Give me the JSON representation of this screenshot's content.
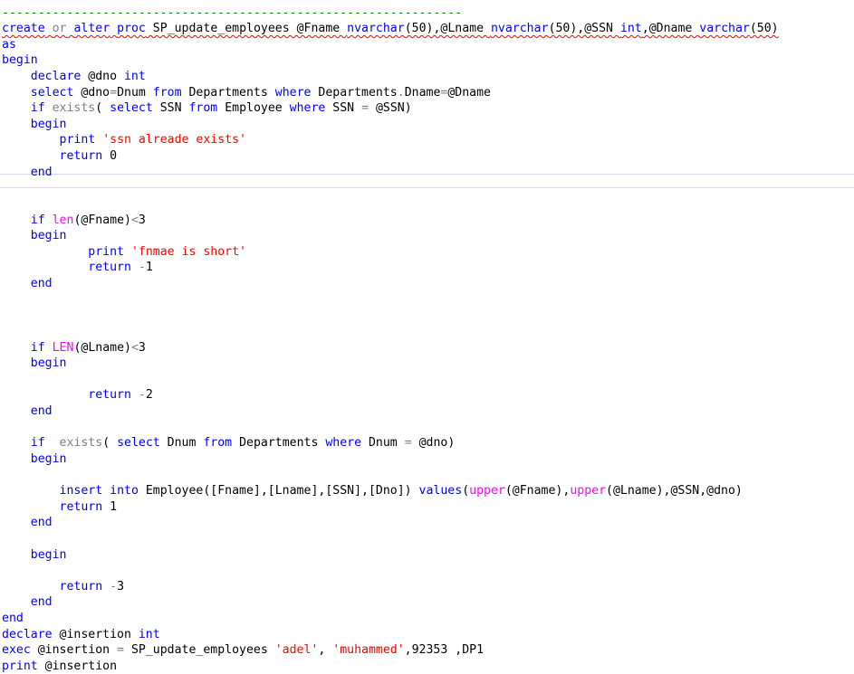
{
  "editor": {
    "lines": [
      {
        "tokens": [
          {
            "t": "----------------------------------------------------------------",
            "c": "cmt"
          }
        ]
      },
      {
        "tokens": [
          {
            "t": "create",
            "c": "kw",
            "err": true
          },
          {
            "t": " ",
            "c": "txt",
            "err": true
          },
          {
            "t": "or",
            "c": "op",
            "err": true
          },
          {
            "t": " ",
            "c": "txt",
            "err": true
          },
          {
            "t": "alter",
            "c": "kw",
            "err": true
          },
          {
            "t": " ",
            "c": "txt",
            "err": true
          },
          {
            "t": "proc",
            "c": "kw",
            "err": true
          },
          {
            "t": " SP_update_employees @Fname ",
            "c": "txt",
            "err": true
          },
          {
            "t": "nvarchar",
            "c": "kw",
            "err": true
          },
          {
            "t": "(50),@Lname ",
            "c": "txt",
            "err": true
          },
          {
            "t": "nvarchar",
            "c": "kw",
            "err": true
          },
          {
            "t": "(50),@SSN ",
            "c": "txt",
            "err": true
          },
          {
            "t": "int",
            "c": "kw",
            "err": true
          },
          {
            "t": ",@Dname ",
            "c": "txt",
            "err": true
          },
          {
            "t": "varchar",
            "c": "kw",
            "err": true
          },
          {
            "t": "(50)",
            "c": "txt",
            "err": true
          }
        ]
      },
      {
        "tokens": [
          {
            "t": "as",
            "c": "kw"
          }
        ]
      },
      {
        "tokens": [
          {
            "t": "begin",
            "c": "kw"
          }
        ]
      },
      {
        "tokens": [
          {
            "t": "    ",
            "c": "txt"
          },
          {
            "t": "declare",
            "c": "kw"
          },
          {
            "t": " @dno ",
            "c": "txt"
          },
          {
            "t": "int",
            "c": "kw"
          }
        ]
      },
      {
        "tokens": [
          {
            "t": "    ",
            "c": "txt"
          },
          {
            "t": "select",
            "c": "kw"
          },
          {
            "t": " @dno",
            "c": "txt"
          },
          {
            "t": "=",
            "c": "op"
          },
          {
            "t": "Dnum ",
            "c": "txt"
          },
          {
            "t": "from",
            "c": "kw"
          },
          {
            "t": " Departments ",
            "c": "txt"
          },
          {
            "t": "where",
            "c": "kw"
          },
          {
            "t": " Departments",
            "c": "txt"
          },
          {
            "t": ".",
            "c": "op"
          },
          {
            "t": "Dname",
            "c": "txt"
          },
          {
            "t": "=",
            "c": "op"
          },
          {
            "t": "@Dname",
            "c": "txt"
          }
        ]
      },
      {
        "tokens": [
          {
            "t": "    ",
            "c": "txt"
          },
          {
            "t": "if",
            "c": "kw"
          },
          {
            "t": " ",
            "c": "txt"
          },
          {
            "t": "exists",
            "c": "op"
          },
          {
            "t": "( ",
            "c": "txt"
          },
          {
            "t": "select",
            "c": "kw"
          },
          {
            "t": " SSN ",
            "c": "txt"
          },
          {
            "t": "from",
            "c": "kw"
          },
          {
            "t": " Employee ",
            "c": "txt"
          },
          {
            "t": "where",
            "c": "kw"
          },
          {
            "t": " SSN ",
            "c": "txt"
          },
          {
            "t": "=",
            "c": "op"
          },
          {
            "t": " @SSN)",
            "c": "txt"
          }
        ]
      },
      {
        "tokens": [
          {
            "t": "    ",
            "c": "txt"
          },
          {
            "t": "begin",
            "c": "kw"
          }
        ]
      },
      {
        "tokens": [
          {
            "t": "        ",
            "c": "txt"
          },
          {
            "t": "print",
            "c": "kw"
          },
          {
            "t": " ",
            "c": "txt"
          },
          {
            "t": "'ssn alreade exists'",
            "c": "str"
          }
        ]
      },
      {
        "tokens": [
          {
            "t": "        ",
            "c": "txt"
          },
          {
            "t": "return",
            "c": "kw"
          },
          {
            "t": " 0",
            "c": "txt"
          }
        ]
      },
      {
        "tokens": [
          {
            "t": "    ",
            "c": "txt"
          },
          {
            "t": "end",
            "c": "kw"
          }
        ]
      },
      {
        "tokens": []
      },
      {
        "tokens": []
      },
      {
        "tokens": [
          {
            "t": "    ",
            "c": "txt"
          },
          {
            "t": "if",
            "c": "kw"
          },
          {
            "t": " ",
            "c": "txt"
          },
          {
            "t": "len",
            "c": "fn"
          },
          {
            "t": "(@Fname)",
            "c": "txt"
          },
          {
            "t": "<",
            "c": "op"
          },
          {
            "t": "3",
            "c": "txt"
          }
        ]
      },
      {
        "tokens": [
          {
            "t": "    ",
            "c": "txt"
          },
          {
            "t": "begin",
            "c": "kw"
          }
        ]
      },
      {
        "tokens": [
          {
            "t": "            ",
            "c": "txt"
          },
          {
            "t": "print",
            "c": "kw"
          },
          {
            "t": " ",
            "c": "txt"
          },
          {
            "t": "'fnmae is short'",
            "c": "str"
          }
        ]
      },
      {
        "tokens": [
          {
            "t": "            ",
            "c": "txt"
          },
          {
            "t": "return",
            "c": "kw"
          },
          {
            "t": " ",
            "c": "txt"
          },
          {
            "t": "-",
            "c": "op"
          },
          {
            "t": "1",
            "c": "txt"
          }
        ]
      },
      {
        "tokens": [
          {
            "t": "    ",
            "c": "txt"
          },
          {
            "t": "end",
            "c": "kw"
          }
        ]
      },
      {
        "tokens": []
      },
      {
        "tokens": []
      },
      {
        "tokens": []
      },
      {
        "tokens": [
          {
            "t": "    ",
            "c": "txt"
          },
          {
            "t": "if",
            "c": "kw"
          },
          {
            "t": " ",
            "c": "txt"
          },
          {
            "t": "LEN",
            "c": "fn"
          },
          {
            "t": "(@Lname)",
            "c": "txt"
          },
          {
            "t": "<",
            "c": "op"
          },
          {
            "t": "3",
            "c": "txt"
          }
        ]
      },
      {
        "tokens": [
          {
            "t": "    ",
            "c": "txt"
          },
          {
            "t": "begin",
            "c": "kw"
          }
        ]
      },
      {
        "tokens": []
      },
      {
        "tokens": [
          {
            "t": "            ",
            "c": "txt"
          },
          {
            "t": "return",
            "c": "kw"
          },
          {
            "t": " ",
            "c": "txt"
          },
          {
            "t": "-",
            "c": "op"
          },
          {
            "t": "2",
            "c": "txt"
          }
        ]
      },
      {
        "tokens": [
          {
            "t": "    ",
            "c": "txt"
          },
          {
            "t": "end",
            "c": "kw"
          }
        ]
      },
      {
        "tokens": []
      },
      {
        "tokens": [
          {
            "t": "    ",
            "c": "txt"
          },
          {
            "t": "if",
            "c": "kw"
          },
          {
            "t": "  ",
            "c": "txt"
          },
          {
            "t": "exists",
            "c": "op"
          },
          {
            "t": "( ",
            "c": "txt"
          },
          {
            "t": "select",
            "c": "kw"
          },
          {
            "t": " Dnum ",
            "c": "txt"
          },
          {
            "t": "from",
            "c": "kw"
          },
          {
            "t": " Departments ",
            "c": "txt"
          },
          {
            "t": "where",
            "c": "kw"
          },
          {
            "t": " Dnum ",
            "c": "txt"
          },
          {
            "t": "=",
            "c": "op"
          },
          {
            "t": " @dno)",
            "c": "txt"
          }
        ]
      },
      {
        "tokens": [
          {
            "t": "    ",
            "c": "txt"
          },
          {
            "t": "begin",
            "c": "kw"
          }
        ]
      },
      {
        "tokens": []
      },
      {
        "tokens": [
          {
            "t": "        ",
            "c": "txt"
          },
          {
            "t": "insert",
            "c": "kw"
          },
          {
            "t": " ",
            "c": "txt"
          },
          {
            "t": "into",
            "c": "kw"
          },
          {
            "t": " Employee([Fname],[Lname],[SSN],[Dno]) ",
            "c": "txt"
          },
          {
            "t": "values",
            "c": "kw"
          },
          {
            "t": "(",
            "c": "txt"
          },
          {
            "t": "upper",
            "c": "fn"
          },
          {
            "t": "(@Fname),",
            "c": "txt"
          },
          {
            "t": "upper",
            "c": "fn"
          },
          {
            "t": "(@Lname),@SSN,@dno)",
            "c": "txt"
          }
        ]
      },
      {
        "tokens": [
          {
            "t": "        ",
            "c": "txt"
          },
          {
            "t": "return",
            "c": "kw"
          },
          {
            "t": " 1",
            "c": "txt"
          }
        ]
      },
      {
        "tokens": [
          {
            "t": "    ",
            "c": "txt"
          },
          {
            "t": "end",
            "c": "kw"
          }
        ]
      },
      {
        "tokens": []
      },
      {
        "tokens": [
          {
            "t": "    ",
            "c": "txt"
          },
          {
            "t": "begin",
            "c": "kw"
          }
        ]
      },
      {
        "tokens": []
      },
      {
        "tokens": [
          {
            "t": "        ",
            "c": "txt"
          },
          {
            "t": "return",
            "c": "kw"
          },
          {
            "t": " ",
            "c": "txt"
          },
          {
            "t": "-",
            "c": "op"
          },
          {
            "t": "3",
            "c": "txt"
          }
        ]
      },
      {
        "tokens": [
          {
            "t": "    ",
            "c": "txt"
          },
          {
            "t": "end",
            "c": "kw"
          }
        ]
      },
      {
        "tokens": [
          {
            "t": "end",
            "c": "kw"
          }
        ]
      },
      {
        "tokens": [
          {
            "t": "declare",
            "c": "kw"
          },
          {
            "t": " @insertion ",
            "c": "txt"
          },
          {
            "t": "int",
            "c": "kw"
          }
        ]
      },
      {
        "tokens": [
          {
            "t": "exec",
            "c": "kw"
          },
          {
            "t": " @insertion ",
            "c": "txt"
          },
          {
            "t": "=",
            "c": "op"
          },
          {
            "t": " SP_update_employees ",
            "c": "txt"
          },
          {
            "t": "'adel'",
            "c": "str"
          },
          {
            "t": ", ",
            "c": "txt"
          },
          {
            "t": "'muhammed'",
            "c": "str"
          },
          {
            "t": ",92353 ,DP1",
            "c": "txt"
          }
        ]
      },
      {
        "tokens": [
          {
            "t": "print",
            "c": "kw"
          },
          {
            "t": " @insertion",
            "c": "txt"
          }
        ]
      }
    ]
  }
}
